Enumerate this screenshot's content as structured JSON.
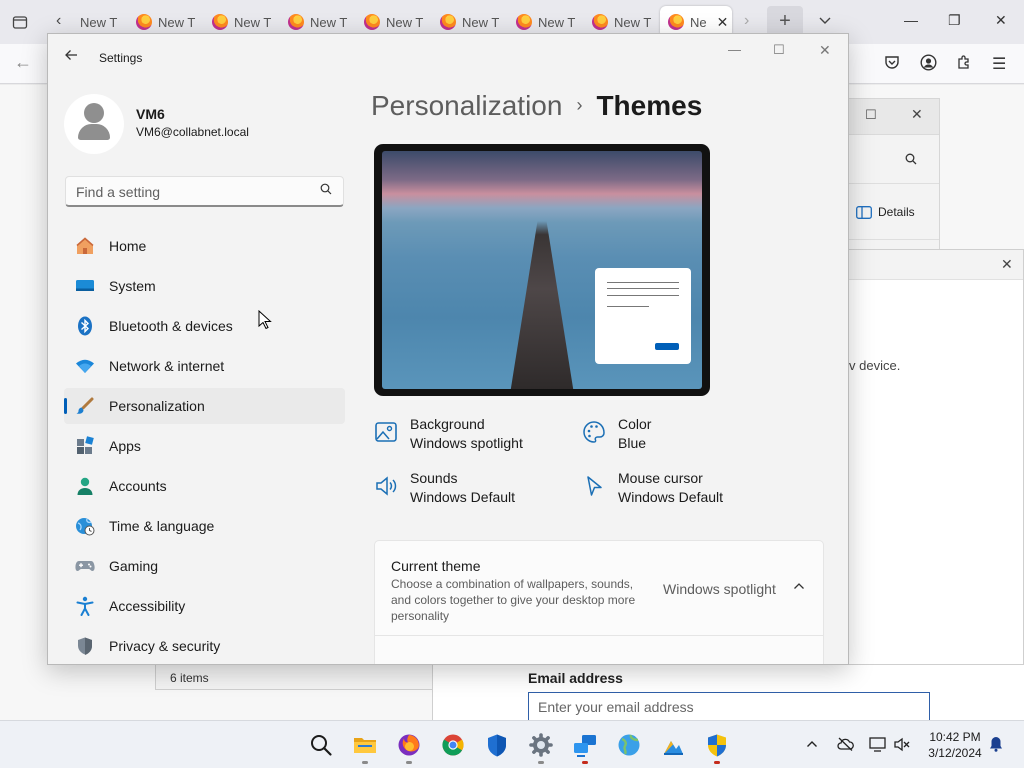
{
  "browser": {
    "tab_label": "New T",
    "active_tab_label": "Ne",
    "toolbar_icons": [
      "back-arrow-icon",
      "pocket-icon",
      "account-icon",
      "extensions-icon",
      "menu-icon"
    ]
  },
  "background": {
    "details_label": "Details",
    "dialog_text": "v device.",
    "status_items": "6 items",
    "email_label": "Email address",
    "email_placeholder": "Enter your email address"
  },
  "settings": {
    "window_title": "Settings",
    "user": {
      "name": "VM6",
      "email": "VM6@collabnet.local"
    },
    "search_placeholder": "Find a setting",
    "nav": [
      {
        "label": "Home",
        "icon": "home-icon"
      },
      {
        "label": "System",
        "icon": "monitor-icon"
      },
      {
        "label": "Bluetooth & devices",
        "icon": "bluetooth-icon"
      },
      {
        "label": "Network & internet",
        "icon": "wifi-icon"
      },
      {
        "label": "Personalization",
        "icon": "brush-icon",
        "selected": true
      },
      {
        "label": "Apps",
        "icon": "apps-icon"
      },
      {
        "label": "Accounts",
        "icon": "person-icon"
      },
      {
        "label": "Time & language",
        "icon": "globe-clock-icon"
      },
      {
        "label": "Gaming",
        "icon": "gamepad-icon"
      },
      {
        "label": "Accessibility",
        "icon": "accessibility-icon"
      },
      {
        "label": "Privacy & security",
        "icon": "shield-icon"
      }
    ],
    "breadcrumb": {
      "parent": "Personalization",
      "separator": "›",
      "current": "Themes"
    },
    "props": {
      "background": {
        "title": "Background",
        "value": "Windows spotlight"
      },
      "color": {
        "title": "Color",
        "value": "Blue"
      },
      "sounds": {
        "title": "Sounds",
        "value": "Windows Default"
      },
      "mouse": {
        "title": "Mouse cursor",
        "value": "Windows Default"
      }
    },
    "current_theme": {
      "title": "Current theme",
      "description": "Choose a combination of wallpapers, sounds, and colors together to give your desktop more personality",
      "value": "Windows spotlight"
    }
  },
  "taskbar": {
    "time": "10:42 PM",
    "date": "3/12/2024"
  },
  "colors": {
    "accent": "#005fb8"
  }
}
